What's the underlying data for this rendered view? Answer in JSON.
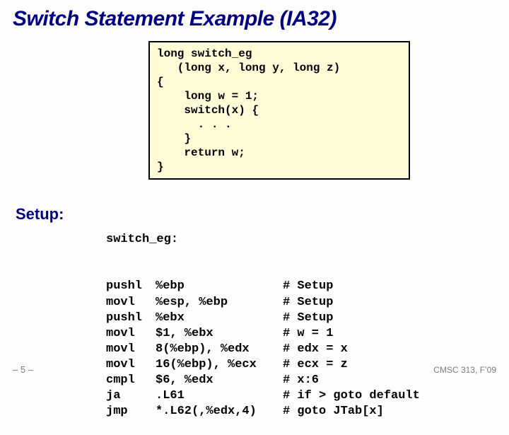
{
  "title": "Switch Statement Example (IA32)",
  "code_c": "long switch_eg\n   (long x, long y, long z)\n{\n    long w = 1;\n    switch(x) {\n      . . .\n    }\n    return w;\n}",
  "setup_label": "Setup:",
  "asm_label": "switch_eg:",
  "asm_rows": [
    {
      "op": "pushl",
      "args": "%ebp",
      "comment": "# Setup"
    },
    {
      "op": "movl",
      "args": "%esp, %ebp",
      "comment": "# Setup"
    },
    {
      "op": "pushl",
      "args": "%ebx",
      "comment": "# Setup"
    },
    {
      "op": "movl",
      "args": "$1, %ebx",
      "comment": "# w = 1"
    },
    {
      "op": "movl",
      "args": "8(%ebp), %edx",
      "comment": "# edx = x"
    },
    {
      "op": "movl",
      "args": "16(%ebp), %ecx",
      "comment": "# ecx = z"
    },
    {
      "op": "cmpl",
      "args": "$6, %edx",
      "comment": "# x:6"
    },
    {
      "op": "ja",
      "args": ".L61",
      "comment": "# if > goto default"
    },
    {
      "op": "jmp",
      "args": "*.L62(,%edx,4)",
      "comment": "# goto JTab[x]"
    }
  ],
  "footer_left": "– 5 –",
  "footer_right": "CMSC 313, F’09"
}
